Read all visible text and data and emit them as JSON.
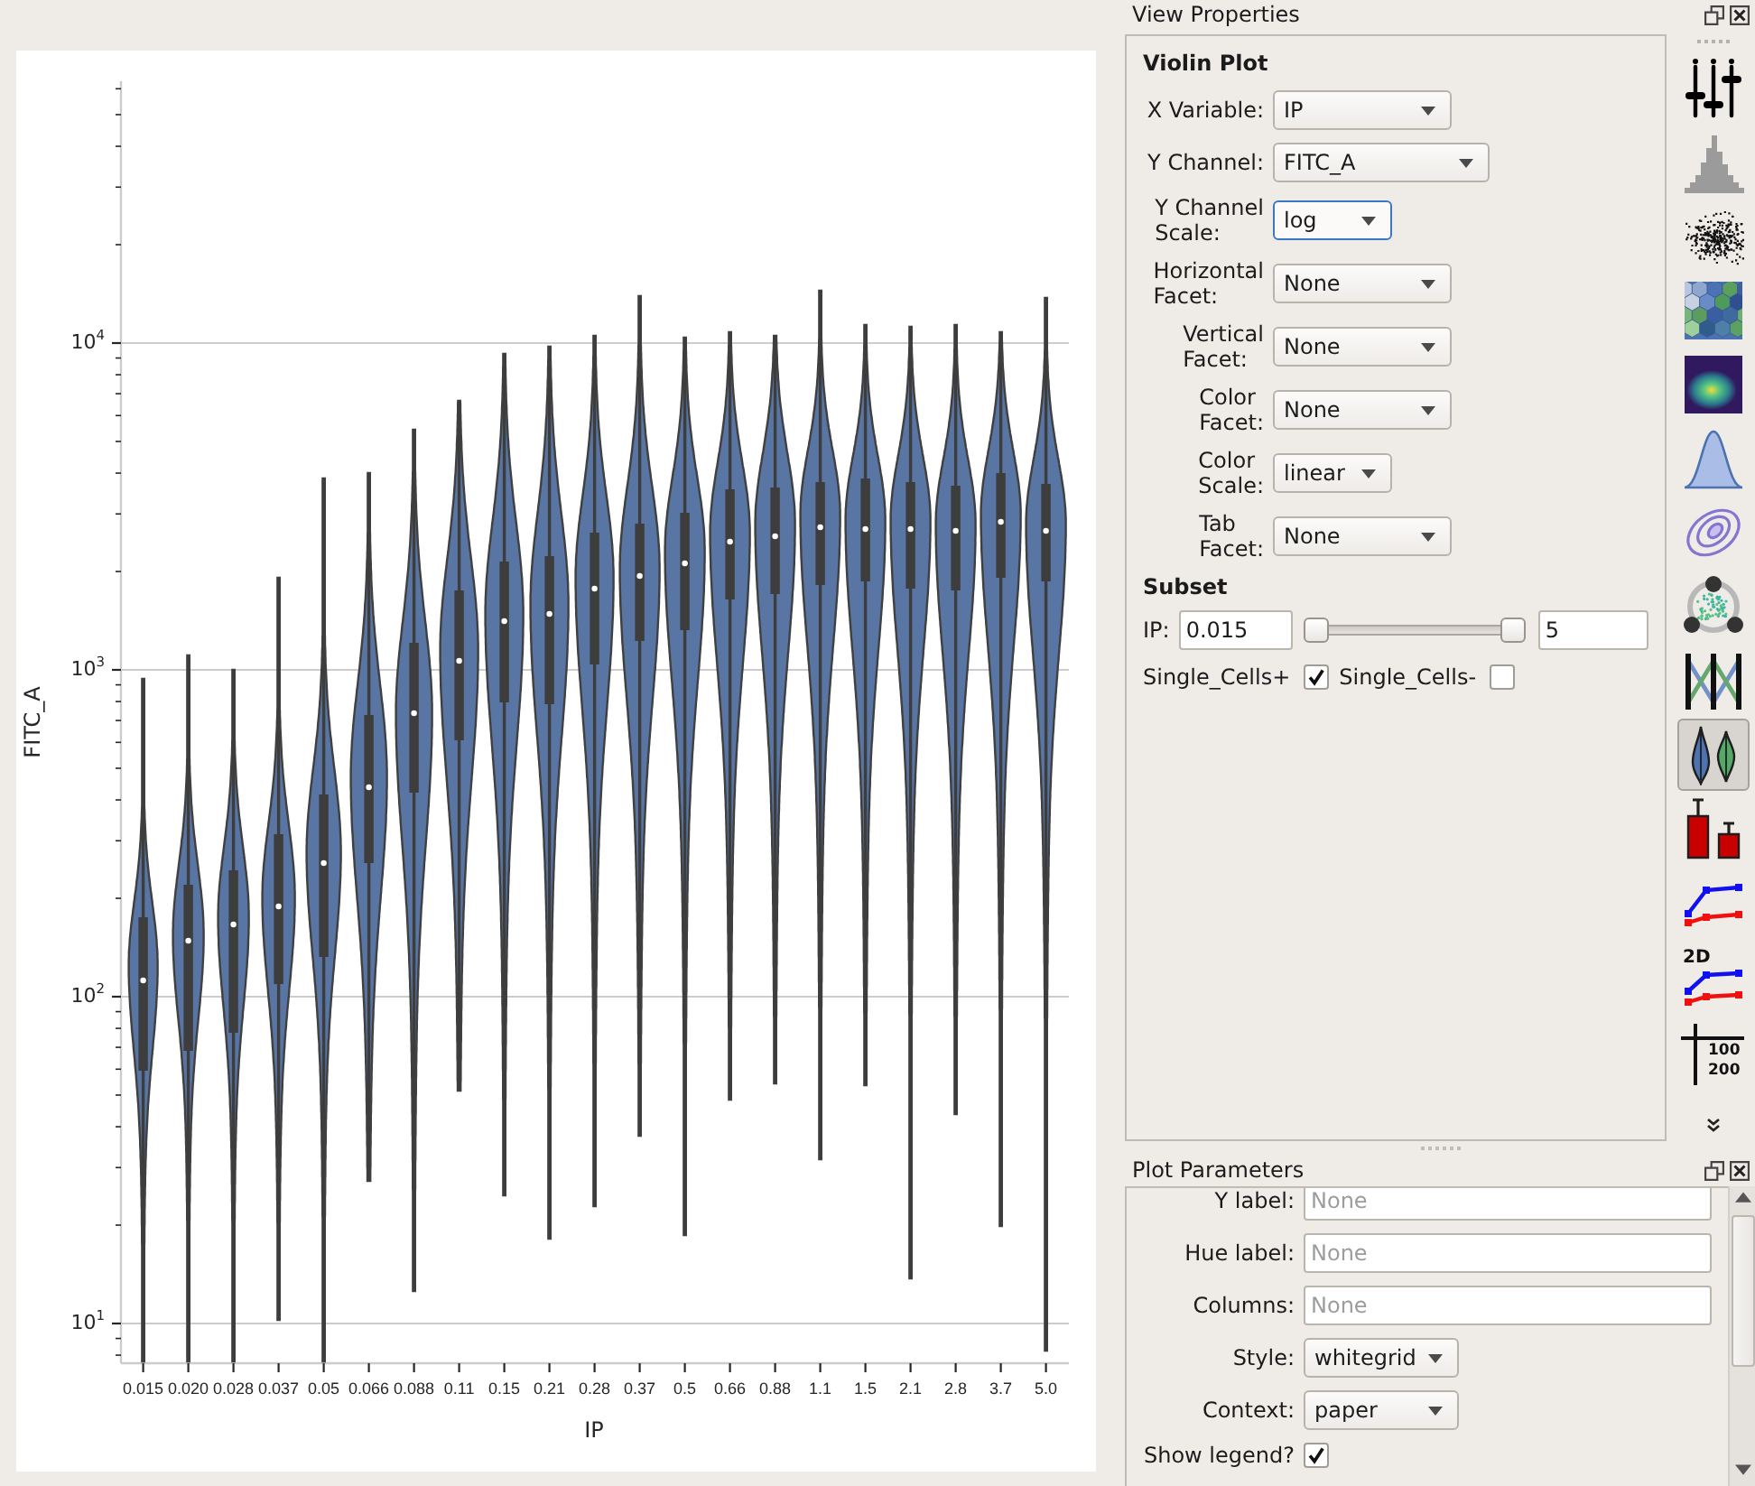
{
  "plot": {
    "y_label": "FITC_A",
    "x_label": "IP",
    "y_tick_labels": [
      "10$^{4}$",
      "10$^{3}$",
      "10$^{2}$",
      "10$^{1}$"
    ],
    "x_tick_labels": [
      "0.015",
      "0.020",
      "0.028",
      "0.037",
      "0.05",
      "0.066",
      "0.088",
      "0.11",
      "0.15",
      "0.21",
      "0.28",
      "0.37",
      "0.5",
      "0.66",
      "0.88",
      "1.1",
      "1.5",
      "2.1",
      "2.8",
      "3.7",
      "5.0"
    ]
  },
  "view_properties": {
    "title": "View Properties",
    "heading": "Violin Plot",
    "fields": [
      {
        "label": "X Variable:",
        "value": "IP",
        "focused": false
      },
      {
        "label": "Y Channel:",
        "value": "FITC_A",
        "focused": false
      },
      {
        "label": "Y Channel Scale:",
        "value": "log",
        "focused": true
      },
      {
        "label": "Horizontal Facet:",
        "value": "None",
        "focused": false
      },
      {
        "label": "Vertical Facet:",
        "value": "None",
        "focused": false
      },
      {
        "label": "Color Facet:",
        "value": "None",
        "focused": false
      },
      {
        "label": "Color Scale:",
        "value": "linear",
        "focused": false
      },
      {
        "label": "Tab Facet:",
        "value": "None",
        "focused": false
      }
    ],
    "subset": {
      "heading": "Subset",
      "range": {
        "label": "IP:",
        "low": "0.015",
        "high": "5",
        "handles": [
          {
            "level": 0
          },
          {
            "level": 1
          }
        ]
      },
      "checks": [
        {
          "label": "Single_Cells+",
          "checked": true
        },
        {
          "label": "Single_Cells-",
          "checked": false
        }
      ]
    }
  },
  "toolbar": {
    "tools": [
      {
        "kind": "sliders",
        "selected": false
      },
      {
        "kind": "histogram",
        "selected": false
      },
      {
        "kind": "scatter",
        "selected": false
      },
      {
        "kind": "hexbin",
        "selected": false
      },
      {
        "kind": "density",
        "selected": false
      },
      {
        "kind": "kde",
        "selected": false
      },
      {
        "kind": "contour",
        "selected": false
      },
      {
        "kind": "radviz",
        "selected": false
      },
      {
        "kind": "parallel",
        "selected": false
      },
      {
        "kind": "violin",
        "selected": true
      },
      {
        "kind": "bar",
        "selected": false
      },
      {
        "kind": "line",
        "selected": false
      },
      {
        "kind": "line2d",
        "label": "2D",
        "selected": false
      },
      {
        "kind": "stats",
        "lines": [
          "100",
          "200"
        ],
        "selected": false
      }
    ]
  },
  "plot_parameters": {
    "title": "Plot Parameters",
    "fields": [
      {
        "kind": "text",
        "label": "Y label:",
        "placeholder": "None"
      },
      {
        "kind": "text",
        "label": "Hue label:",
        "placeholder": "None"
      },
      {
        "kind": "text",
        "label": "Columns:",
        "placeholder": "None"
      },
      {
        "kind": "combo",
        "label": "Style:",
        "value": "whitegrid"
      },
      {
        "kind": "combo",
        "label": "Context:",
        "value": "paper"
      },
      {
        "kind": "check",
        "label": "Show legend?",
        "checked": true
      }
    ]
  }
}
